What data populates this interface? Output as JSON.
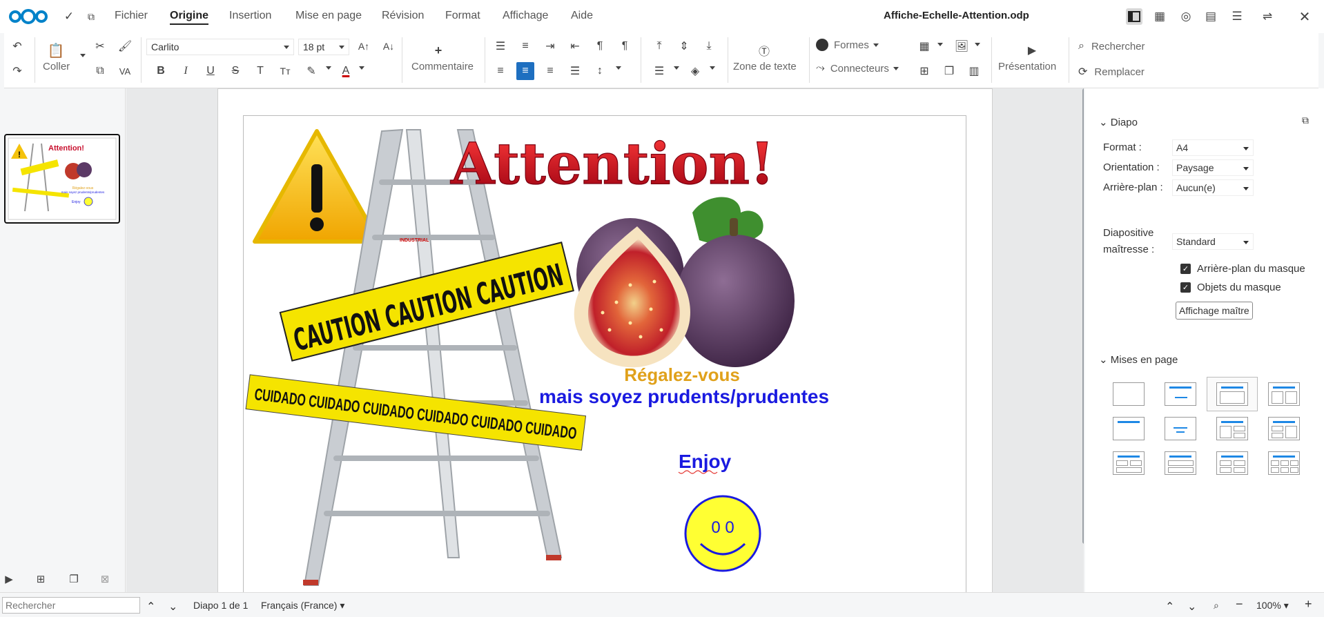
{
  "app": {
    "title": "Affiche-Echelle-Attention.odp"
  },
  "menu": {
    "items": [
      "Fichier",
      "Origine",
      "Insertion",
      "Mise en page",
      "Révision",
      "Format",
      "Affichage",
      "Aide"
    ],
    "active": "Origine"
  },
  "toolbar": {
    "paste_label": "Coller",
    "font_name": "Carlito",
    "font_size": "18 pt",
    "comment_label": "Commentaire",
    "textbox_label": "Zone de texte",
    "shapes_label": "Formes",
    "connectors_label": "Connecteurs",
    "presentation_label": "Présentation",
    "search_label": "Rechercher",
    "replace_label": "Remplacer"
  },
  "slide": {
    "title": "Attention!",
    "caution_text": "CAUTION CAUTION CAUTION",
    "cuidado_text": "CUIDADO CUIDADO CUIDADO CUIDADO CUIDADO CUIDADO",
    "ladder_brand": "INDUSTRIAL",
    "line1": "Régalez-vous",
    "line2": "mais soyez prudents/prudentes",
    "enjoy": "Enjoy",
    "smiley_eyes": "0  0",
    "colors": {
      "title": "#c8102e",
      "line1": "#e0a11b",
      "line2": "#1a1ae0",
      "enjoy": "#1a1ae0",
      "smiley_fill": "#ffff33",
      "smiley_stroke": "#1a1ae0",
      "tape": "#f5e400"
    }
  },
  "thumbnail": {
    "title": "Attention!",
    "line1": "Régalez-vous",
    "line2": "mais soyez prudents/prudentes",
    "enjoy": "Enjoy",
    "caution": "CAUTION CAUTION CAUTION",
    "cuidado": "CUIDADO CUIDADO CUIDADO"
  },
  "sidebar": {
    "section_diapo": "Diapo",
    "format_label": "Format :",
    "format_value": "A4",
    "orientation_label": "Orientation :",
    "orientation_value": "Paysage",
    "background_label": "Arrière-plan :",
    "background_value": "Aucun(e)",
    "master_label_1": "Diapositive",
    "master_label_2": "maîtresse :",
    "master_value": "Standard",
    "chk_bg": "Arrière-plan du masque",
    "chk_obj": "Objets du masque",
    "master_view_btn": "Affichage maître",
    "section_layouts": "Mises en page"
  },
  "statusbar": {
    "search_placeholder": "Rechercher",
    "slide_info": "Diapo 1 de 1",
    "language": "Français (France)",
    "zoom": "100%"
  }
}
